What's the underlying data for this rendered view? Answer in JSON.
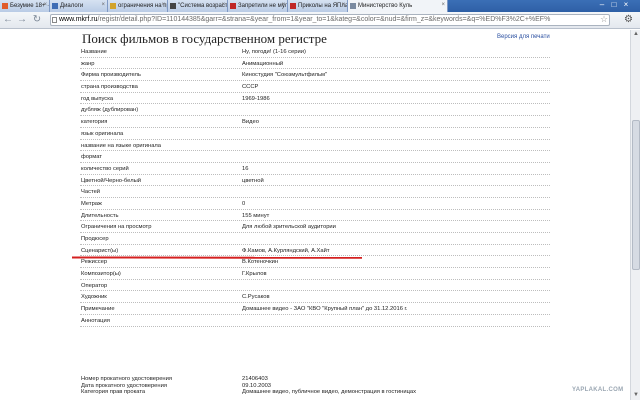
{
  "browser": {
    "tabs": [
      {
        "label": "Безумие 18+ ·",
        "active": false,
        "icon": "site-icon",
        "icon_color": "#e05b2b"
      },
      {
        "label": "Диалоги",
        "active": false,
        "icon": "site-icon",
        "icon_color": "#3f6db5"
      },
      {
        "label": "ограничения на пр",
        "active": false,
        "icon": "doc-icon",
        "icon_color": "#d2a32b"
      },
      {
        "label": "\"Система возрастн",
        "active": false,
        "icon": "wikipedia-icon",
        "icon_color": "#444444"
      },
      {
        "label": "Запретили не муль",
        "active": false,
        "icon": "site-icon",
        "icon_color": "#c02727"
      },
      {
        "label": "Приколы на ЯПлак",
        "active": false,
        "icon": "site-icon",
        "icon_color": "#c02727"
      },
      {
        "label": "Министерство Куль",
        "active": true,
        "icon": "doc-icon",
        "icon_color": "#7a8aa0"
      }
    ],
    "url_host": "www.mkrf.ru",
    "url_path": "/registr/detail.php?ID=110144385&garr=&strana=&year_from=1&year_to=1&kateg=&color=&nud=&firm_z=&keywords=&q=%ED%F3%2C+%EF%",
    "icons": {
      "back": "back-arrow-icon",
      "forward": "forward-arrow-icon",
      "reload": "reload-icon",
      "star": "star-icon",
      "menu": "wrench-icon"
    }
  },
  "page": {
    "title": "Поиск фильмов в государственном регистре",
    "print_link": "Версия для печати",
    "rows": [
      {
        "label": "Название",
        "value": "Ну, погоди! (1-16 серии)"
      },
      {
        "label": "жанр",
        "value": "Анимационный"
      },
      {
        "label": "Фирма производитель",
        "value": "Киностудия \"Союзмультфильм\""
      },
      {
        "label": "страна производства",
        "value": "СССР"
      },
      {
        "label": "год выпуска",
        "value": "1969-1986"
      },
      {
        "label": "дубляж (дублирован)",
        "value": ""
      },
      {
        "label": "категория",
        "value": "Видео"
      },
      {
        "label": "язык оригинала",
        "value": ""
      },
      {
        "label": "название на языке оригинала",
        "value": ""
      },
      {
        "label": "формат",
        "value": ""
      },
      {
        "label": "количество серий",
        "value": "16"
      },
      {
        "label": "Цветной/Черно-белый",
        "value": "цветной"
      },
      {
        "label": "Частей",
        "value": ""
      },
      {
        "label": "Метраж",
        "value": "0"
      },
      {
        "label": "Длительность",
        "value": "155 минут"
      },
      {
        "label": "Ограничения на просмотр",
        "value": "Для любой зрительской аудитории"
      },
      {
        "label": "Продюсер",
        "value": ""
      },
      {
        "label": "Сценарист(ы)",
        "value": "Ф.Камов, А.Курляндский, А.Хайт"
      },
      {
        "label": "Режиссер",
        "value": "В.Котеночкин"
      },
      {
        "label": "Композитор(ы)",
        "value": "Г.Крылов"
      },
      {
        "label": "Оператор",
        "value": ""
      },
      {
        "label": "Художник",
        "value": "С.Русаков"
      },
      {
        "label": "Примечание",
        "value": "Домашнее видео - ЗАО \"КВО \"Крупный план\" до 31.12.2016 г."
      },
      {
        "label": "Аннотация",
        "value": ""
      }
    ],
    "certificate_rows": [
      {
        "label": "Номер прокатного удостоверения",
        "value": "21406403"
      },
      {
        "label": "Дата прокатного удостоверения",
        "value": "09.10.2003"
      },
      {
        "label": "Категория прав проката",
        "value": "Домашнее видео, публичное видео, демонстрация в гостиницах"
      }
    ],
    "highlight_color": "#d42020"
  },
  "watermark": "YAPLAKAL.COM"
}
